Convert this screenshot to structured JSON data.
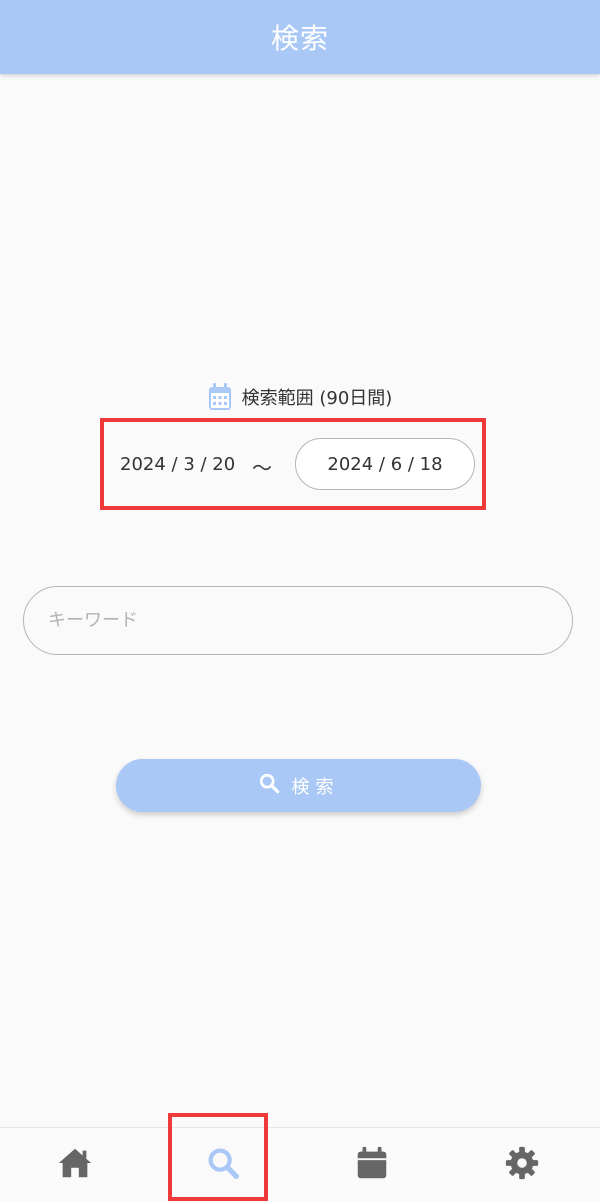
{
  "header": {
    "title": "検索"
  },
  "range": {
    "label": "検索範囲 (90日間)",
    "start": "2024 / 3 / 20",
    "separator": "〜",
    "end": "2024 / 6 / 18"
  },
  "keyword": {
    "placeholder": "キーワード",
    "value": ""
  },
  "search_button": {
    "label": "検索"
  },
  "colors": {
    "accent": "#a9c8f5",
    "nav_icon": "#666666",
    "highlight": "#f03a3a"
  },
  "nav": {
    "items": [
      {
        "icon": "home-icon",
        "active": false
      },
      {
        "icon": "search-icon",
        "active": true
      },
      {
        "icon": "calendar-icon",
        "active": false
      },
      {
        "icon": "gear-icon",
        "active": false
      }
    ]
  }
}
